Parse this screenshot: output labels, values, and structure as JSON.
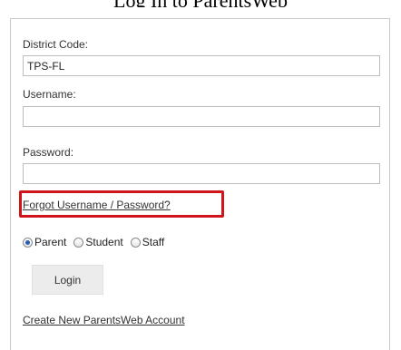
{
  "page": {
    "top_text": "Log In to ParentsWeb"
  },
  "form": {
    "district_code": {
      "label": "District Code:",
      "value": "TPS-FL",
      "placeholder": ""
    },
    "username": {
      "label": "Username:",
      "value": "",
      "placeholder": ""
    },
    "password": {
      "label": "Password:",
      "value": "",
      "placeholder": ""
    },
    "forgot_link": "Forgot Username / Password?",
    "roles": [
      {
        "label": "Parent",
        "selected": true
      },
      {
        "label": "Student",
        "selected": false
      },
      {
        "label": "Staff",
        "selected": false
      }
    ],
    "login_button": "Login",
    "create_account_link": "Create New ParentsWeb Account"
  },
  "colors": {
    "highlight_border": "#d0141c",
    "radio_selected": "#2a5bb8",
    "button_bg": "#ececec"
  }
}
